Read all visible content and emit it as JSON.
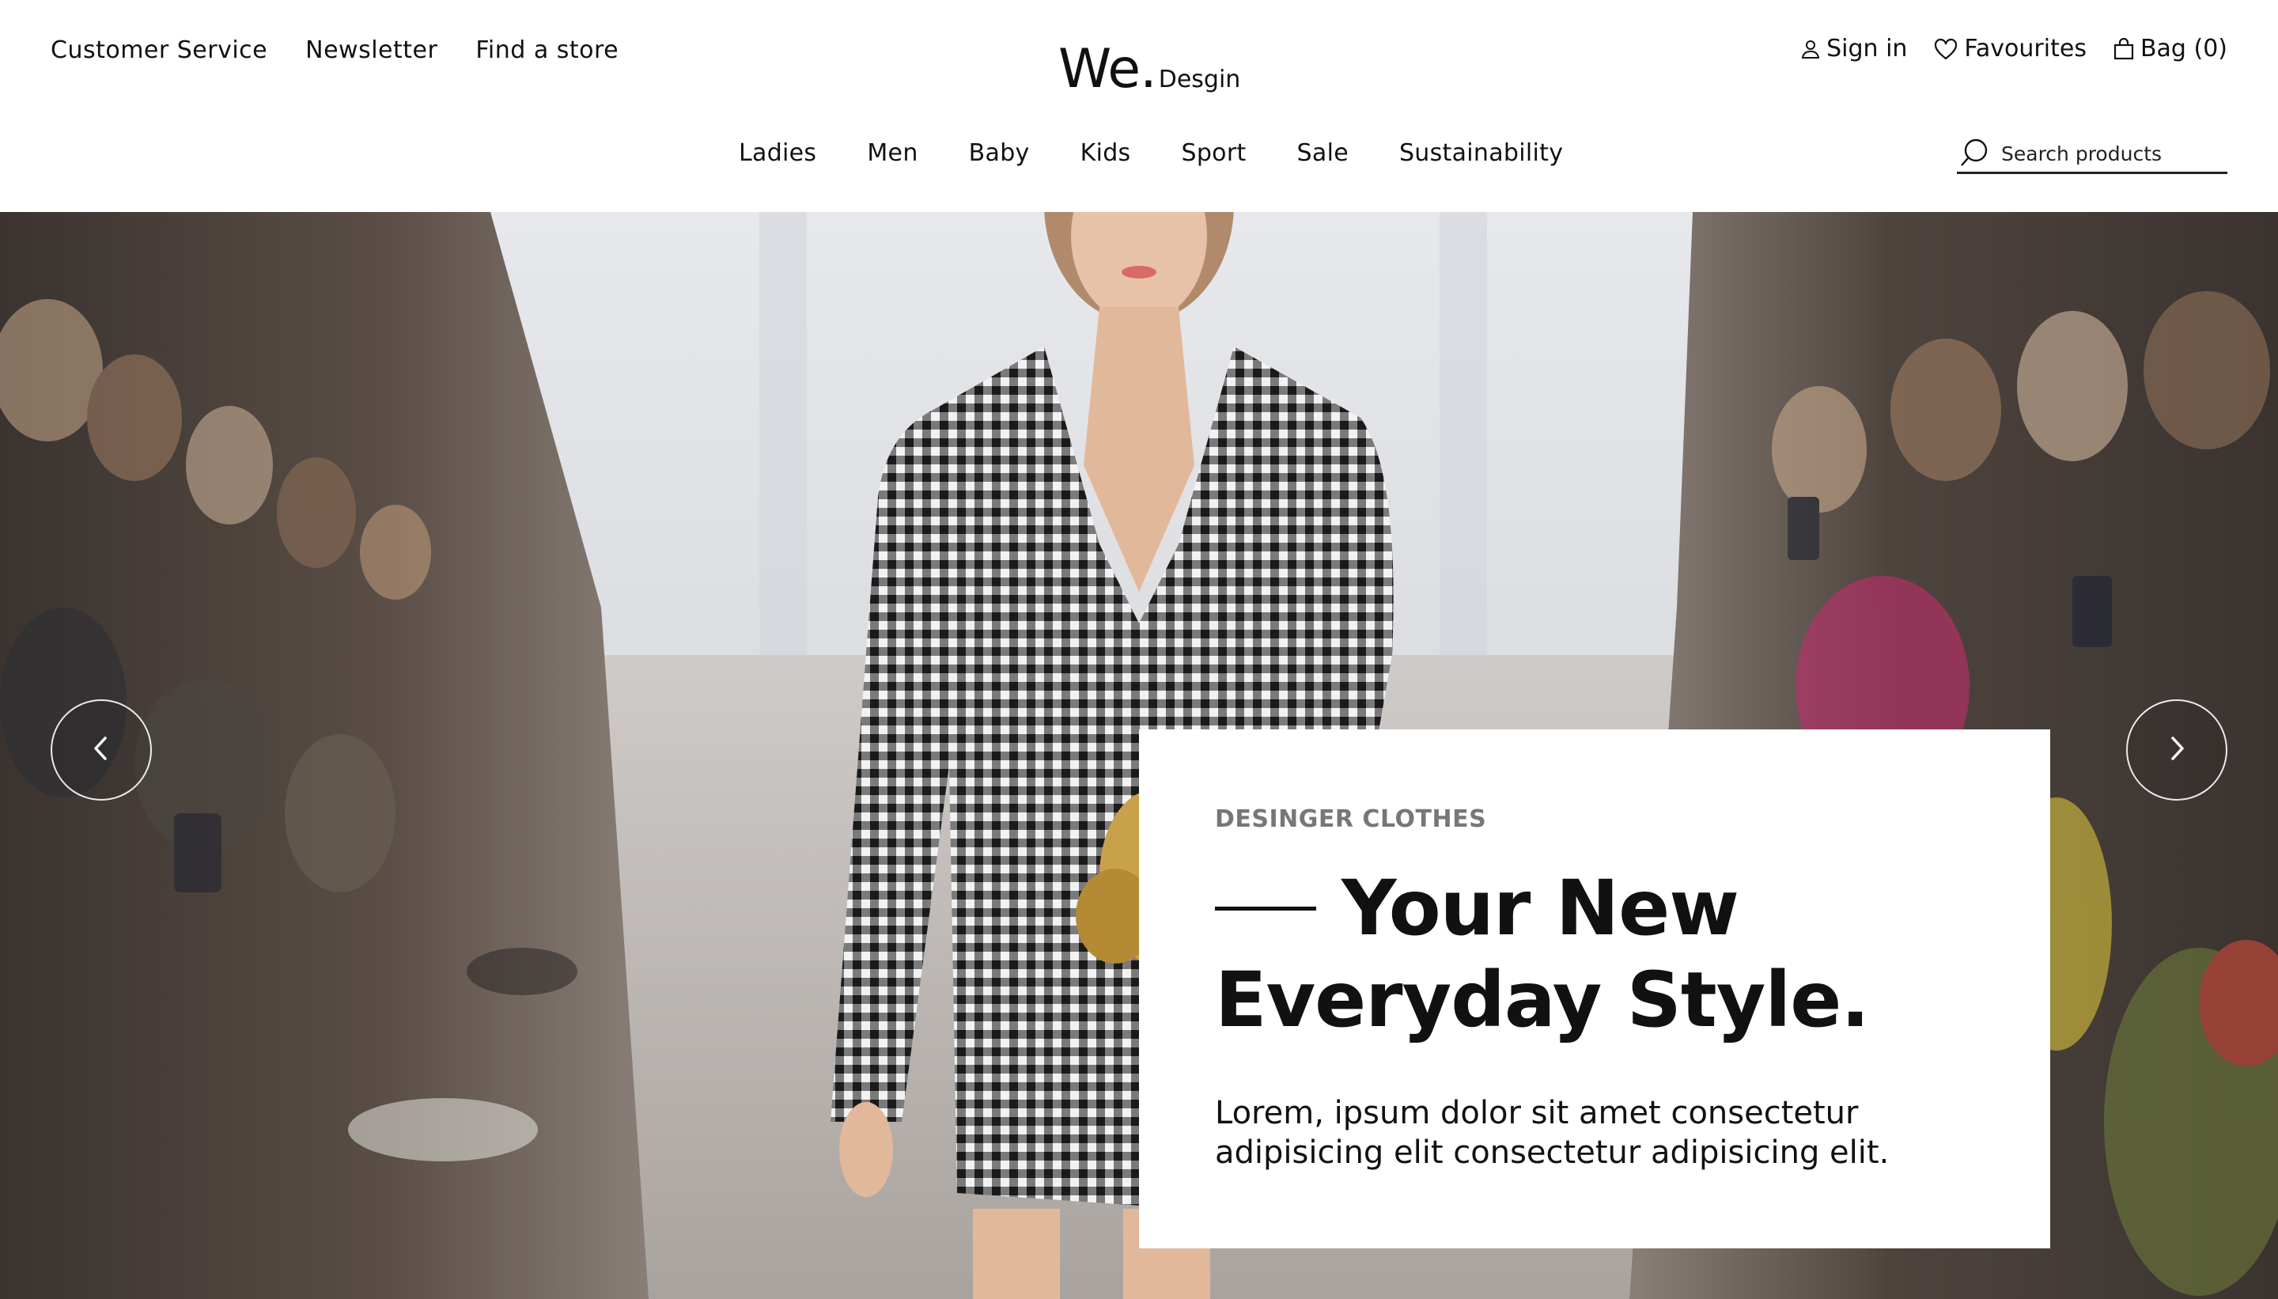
{
  "header": {
    "utility_left": [
      "Customer Service",
      "Newsletter",
      "Find a store"
    ],
    "logo": {
      "main": "We",
      "dot": ".",
      "sub": "Desgin"
    },
    "utility_right": {
      "sign_in": "Sign in",
      "favourites": "Favourites",
      "bag": "Bag (0)"
    },
    "nav": [
      "Ladies",
      "Men",
      "Baby",
      "Kids",
      "Sport",
      "Sale",
      "Sustainability"
    ],
    "search": {
      "placeholder": "Search products"
    }
  },
  "hero": {
    "kicker": "DESINGER CLOTHES",
    "headline_line1": "Your New",
    "headline_line2": "Everyday Style.",
    "body": "Lorem, ipsum dolor sit amet consectetur adipisicing elit consectetur adipisicing elit."
  },
  "icons": {
    "user": "user-icon",
    "heart": "heart-icon",
    "bag": "shopping-bag-icon",
    "search": "search-icon",
    "prev": "chevron-left-icon",
    "next": "chevron-right-icon"
  },
  "colors": {
    "text": "#111111",
    "kicker": "#777777",
    "background": "#ffffff"
  }
}
